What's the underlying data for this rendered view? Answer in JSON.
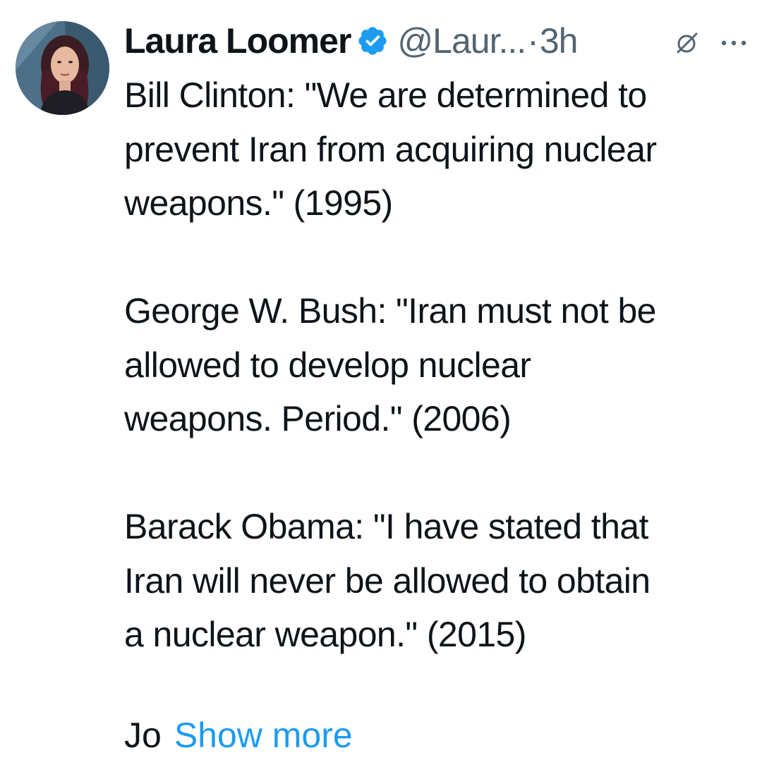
{
  "author": {
    "display_name": "Laura Loomer",
    "verified_icon": "verified-badge-icon",
    "handle": "@Laur...",
    "separator": "·",
    "time": "3h",
    "avatar_icon": "profile-photo"
  },
  "actions": {
    "grok_icon": "grok-icon",
    "more_icon": "more-options-icon"
  },
  "tweet": {
    "paragraphs": [
      "Bill Clinton: \"We are determined to\nprevent Iran from acquiring nuclear\nweapons.\" (1995)",
      "George W. Bush: \"Iran must not be\nallowed to develop nuclear\nweapons. Period.\" (2006)",
      "Barack Obama: \"I have stated that\nIran will never be allowed to obtain\na nuclear weapon.\" (2015)"
    ],
    "truncated_prefix": "Jo",
    "show_more_label": "Show more"
  },
  "colors": {
    "text": "#0f1419",
    "secondary": "#536471",
    "accent": "#1d9bf0"
  }
}
